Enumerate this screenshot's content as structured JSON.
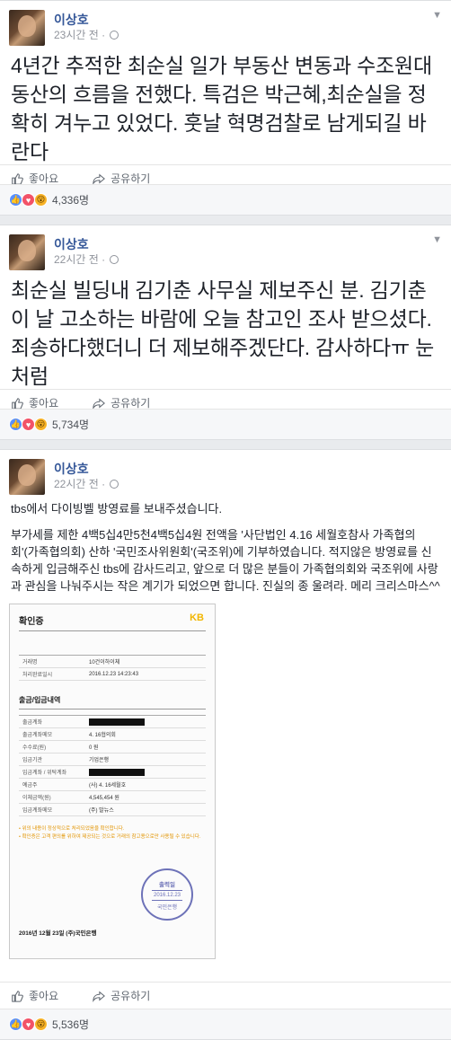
{
  "posts": [
    {
      "author": "이상호",
      "time": "23시간 전",
      "text": "4년간 추적한 최순실 일가 부동산 변동과 수조원대 동산의 흐름을 전했다. 특검은 박근혜,최순실을 정확히 겨누고 있었다. 훗날 혁명검찰로 남게되길 바란다",
      "like_label": "좋아요",
      "share_label": "공유하기",
      "reaction_count": "4,336명"
    },
    {
      "author": "이상호",
      "time": "22시간 전",
      "text": "최순실 빌딩내 김기춘 사무실 제보주신 분. 김기춘이 날 고소하는 바람에 오늘 참고인 조사 받으셨다. 죄송하다했더니 더 제보해주겠단다. 감사하다ㅠ 눈처럼",
      "like_label": "좋아요",
      "share_label": "공유하기",
      "reaction_count": "5,734명"
    },
    {
      "author": "이상호",
      "time": "22시간 전",
      "para1": "tbs에서 다이빙벨 방영료를 보내주셨습니다.",
      "para2": "부가세를 제한 4백5십4만5천4백5십4원 전액을 '사단법인 4.16 세월호참사 가족협의회'(가족협의회) 산하 '국민조사위원회'(국조위)에 기부하였습니다. 적지않은 방영료를 신속하게 입금해주신 tbs에 감사드리고, 앞으로 더 많은 분들이 가족협의회와 국조위에 사랑과 관심을 나눠주시는 작은 계기가 되었으면 합니다. 진실의 종 울려라. 메리 크리스마스^^",
      "like_label": "좋아요",
      "share_label": "공유하기",
      "reaction_count": "5,536명",
      "receipt": {
        "title": "확인증",
        "logo": "KB",
        "rows1": [
          {
            "k": "거래명",
            "v": "10건이하이체"
          },
          {
            "k": "처리완료일시",
            "v": "2016.12.23 14:23:43"
          }
        ],
        "section": "출금/입금내역",
        "rows2": [
          {
            "k": "출금계좌",
            "v": ""
          },
          {
            "k": "출금계좌메모",
            "v": "4. 16협의회"
          },
          {
            "k": "수수료(원)",
            "v": "0 원"
          },
          {
            "k": "입금기관",
            "v": "기업은행"
          },
          {
            "k": "입금계좌 / 위탁계좌",
            "v": ""
          },
          {
            "k": "예금주",
            "v": "(사) 4. 16세월호"
          },
          {
            "k": "이체금액(원)",
            "v": "4,545,454 원"
          },
          {
            "k": "입금계좌메모",
            "v": "(주) 발뉴스"
          }
        ],
        "note1": "• 위의 내용이 정상적으로 처리되었음을 확인합니다.",
        "note2": "• 확인증은 고객 편의를 위하여 제공되는 것으로 거래의 참고용으로만 사용될 수 있습니다.",
        "stamp_top": "출력일",
        "stamp_date": "2016.12.23",
        "stamp_bottom": "국민은행",
        "footer": "2016년 12월 23일 (주)국민은행"
      }
    }
  ]
}
